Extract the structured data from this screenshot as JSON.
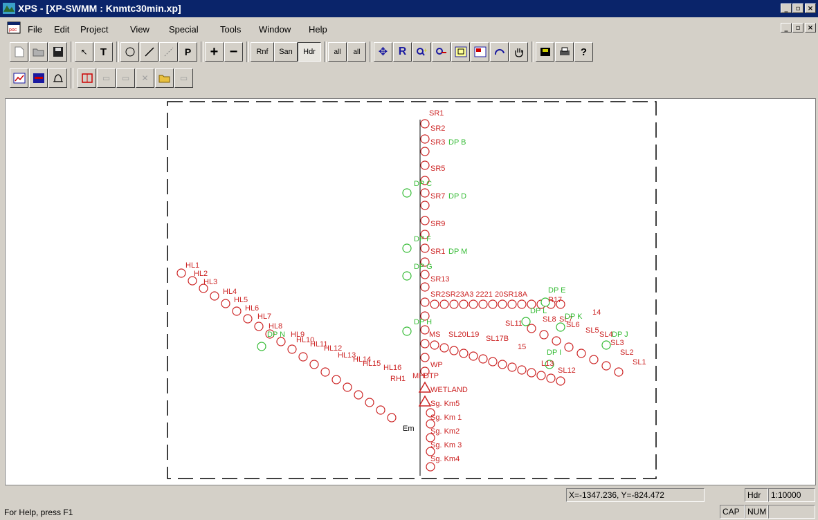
{
  "window": {
    "title": "XPS - [XP-SWMM : Knmtc30min.xp]",
    "min_icon": "minimize-icon",
    "restore_icon": "restore-icon",
    "close_icon": "close-icon"
  },
  "menu": {
    "items": [
      "File",
      "Edit",
      "Project",
      "View",
      "Special",
      "Tools",
      "Window",
      "Help"
    ]
  },
  "toolbar1": {
    "new_icon": "new-file-icon",
    "open_icon": "open-folder-icon",
    "save_icon": "save-icon",
    "select_icon": "arrow-select-icon",
    "text_label": "T",
    "node_icon": "circle-node-icon",
    "link_icon": "line-link-icon",
    "multilink_icon": "dashed-link-icon",
    "p_label": "P",
    "zoom_in_label": "+",
    "zoom_out_label": "−",
    "mode_rnf": "Rnf",
    "mode_san": "San",
    "mode_hdr": "Hdr",
    "all_links_label": "all",
    "all_nodes_label": "all"
  },
  "toolbar2": {
    "graph_icon": "graph-icon",
    "profile_icon": "profile-icon",
    "bell_icon": "bell-icon"
  },
  "network": {
    "labels_red": [
      "SR1",
      "SR2",
      "SR3",
      "SR5",
      "SR7",
      "SR9",
      "SR1",
      "SR13",
      "SR2SR23A3 2221 20SR18A",
      "R17",
      "HL1",
      "HL2",
      "HL3",
      "HL4",
      "HL5",
      "HL6",
      "HL7",
      "HL8",
      "HL9",
      "HL10",
      "HL11",
      "HL12",
      "HL13",
      "HL14",
      "HL15",
      "HL16",
      "RH1",
      "MH",
      "DTP",
      "WETLAND",
      "Sg. Km5",
      "Sg. Km 1",
      "Sg. Km2",
      "Sg. Km 3",
      "Sg. Km4",
      "MS",
      "SL20",
      "L19",
      "SL17B",
      "SL1",
      "SL2",
      "SL3",
      "SL4",
      "SL5",
      "SL6",
      "SL7",
      "SL8",
      "SL11",
      "SL12",
      "L13",
      "WP",
      "14",
      "15",
      "Em"
    ],
    "labels_green": [
      "DP B",
      "DP C",
      "DP D",
      "DP F",
      "DP M",
      "DP G",
      "DP H",
      "DP E",
      "DP K",
      "DP J",
      "DP L",
      "DP I",
      "DP N"
    ]
  },
  "status": {
    "help": "For Help, press F1",
    "coords": "X=-1347.236, Y=-824.472",
    "mode": "Hdr",
    "scale": "1:10000",
    "cap": "CAP",
    "num": "NUM"
  },
  "colors": {
    "titlebar": "#0a246a",
    "chrome": "#d4d0c8",
    "node_red": "#cc2222",
    "node_green": "#33bb33",
    "label_yellow": "#e6e600",
    "link_blue": "#3333cc"
  }
}
